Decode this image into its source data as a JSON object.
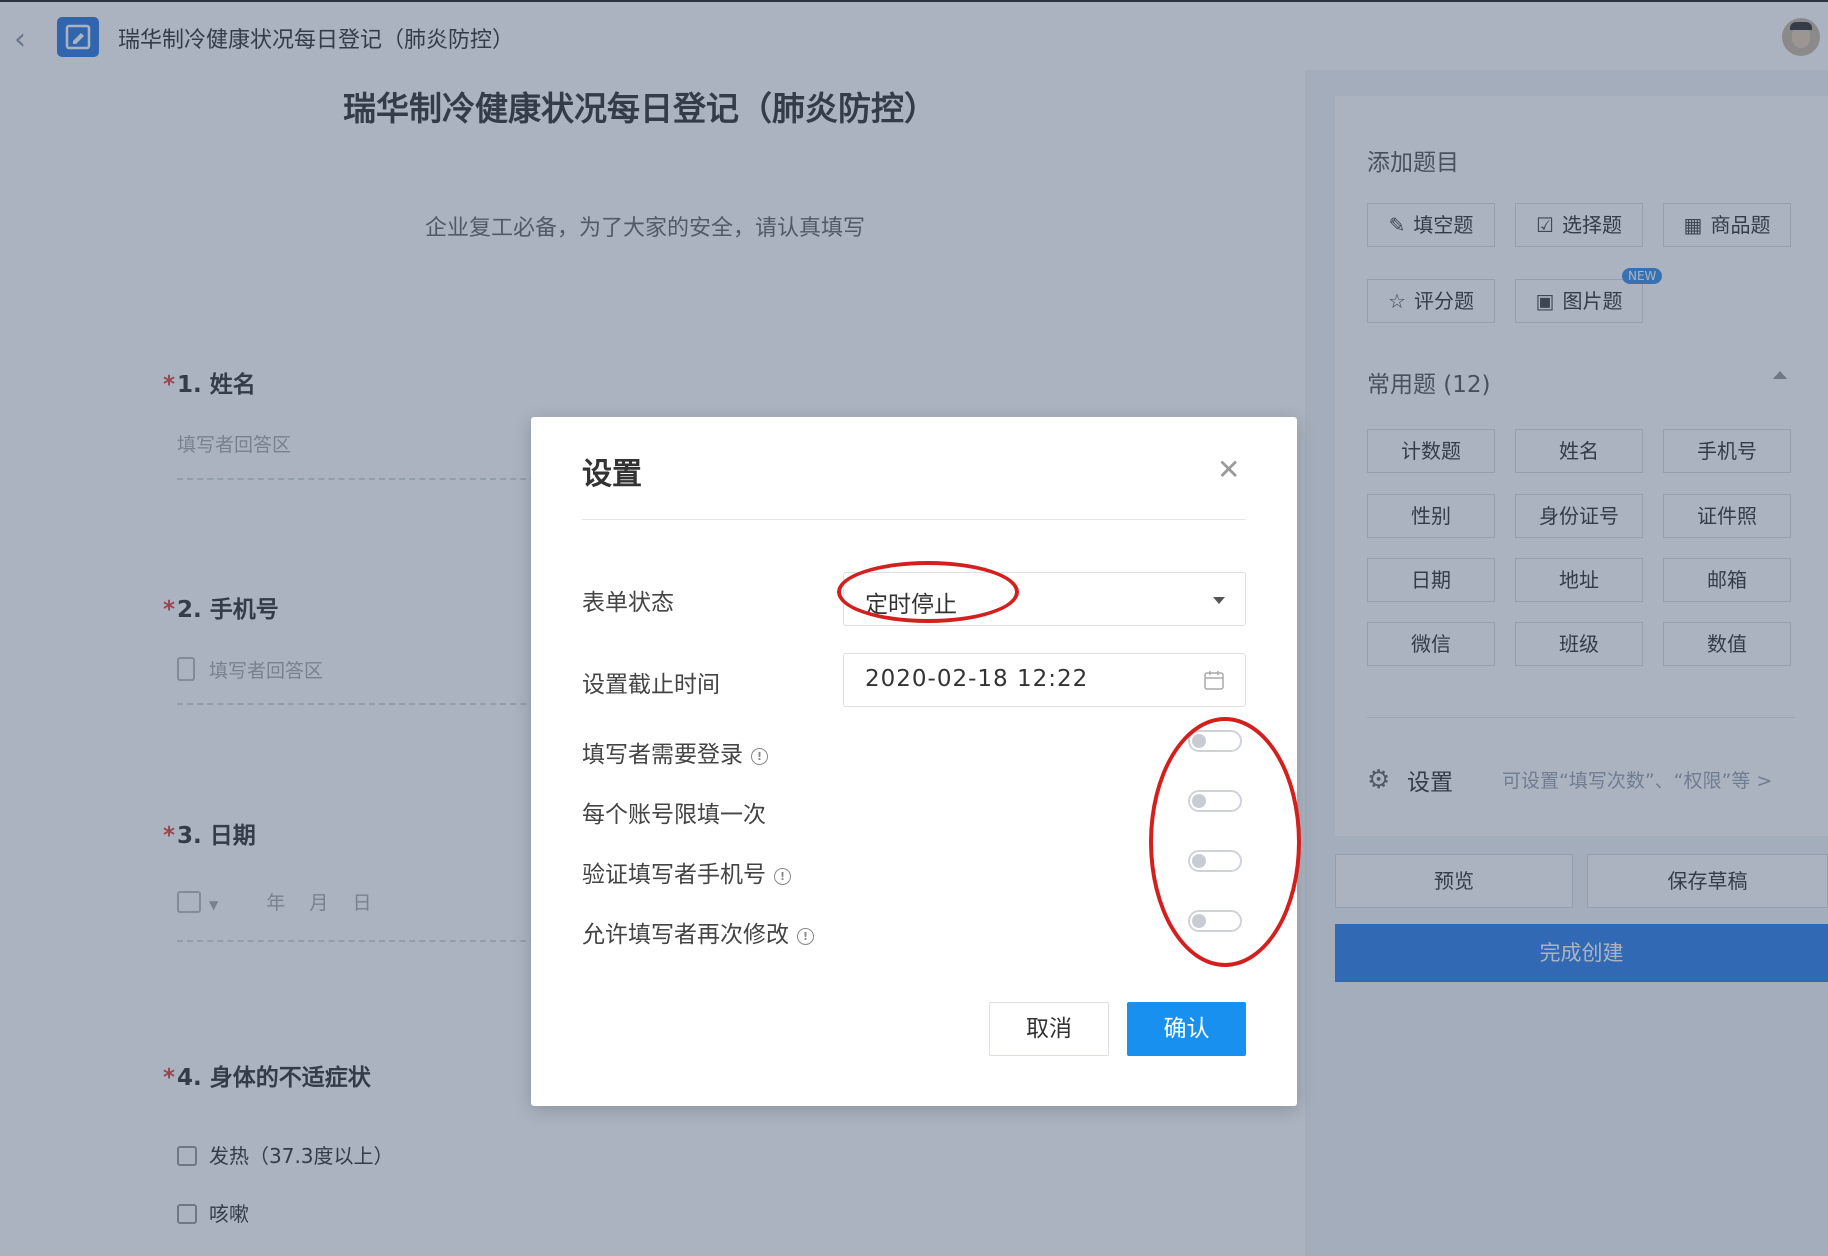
{
  "app": {
    "title": "瑞华制冷健康状况每日登记（肺炎防控）"
  },
  "form": {
    "title": "瑞华制冷健康状况每日登记（肺炎防控）",
    "description": "企业复工必备，为了大家的安全，请认真填写",
    "questions": [
      {
        "number": "1.",
        "label": "姓名",
        "placeholder": "填写者回答区"
      },
      {
        "number": "2.",
        "label": "手机号",
        "placeholder": "填写者回答区"
      },
      {
        "number": "3.",
        "label": "日期",
        "date_parts": "年    月    日"
      },
      {
        "number": "4.",
        "label": "身体的不适症状",
        "options": [
          "发热（37.3度以上）",
          "咳嗽"
        ]
      }
    ],
    "required_mark": "*"
  },
  "right_panel": {
    "add_title": "添加题目",
    "add_buttons": [
      "填空题",
      "选择题",
      "商品题",
      "评分题",
      "图片题"
    ],
    "new_badge": "NEW",
    "common_title": "常用题 (12)",
    "common_items": [
      "计数题",
      "姓名",
      "手机号",
      "性别",
      "身份证号",
      "证件照",
      "日期",
      "地址",
      "邮箱",
      "微信",
      "班级",
      "数值"
    ],
    "settings_label": "设置",
    "settings_hint": "可设置“填写次数”、“权限”等 >",
    "preview": "预览",
    "save_draft": "保存草稿",
    "finish": "完成创建"
  },
  "modal": {
    "title": "设置",
    "form_status_label": "表单状态",
    "form_status_value": "定时停止",
    "deadline_label": "设置截止时间",
    "deadline_value": "2020-02-18 12:22",
    "toggles": [
      {
        "label": "填写者需要登录",
        "info": true,
        "on": false
      },
      {
        "label": "每个账号限填一次",
        "info": false,
        "on": false
      },
      {
        "label": "验证填写者手机号",
        "info": true,
        "on": false
      },
      {
        "label": "允许填写者再次修改",
        "info": true,
        "on": false
      }
    ],
    "cancel": "取消",
    "confirm": "确认"
  },
  "colors": {
    "primary": "#1890f0",
    "annotation": "#d41f1f",
    "required": "#e0443b"
  }
}
